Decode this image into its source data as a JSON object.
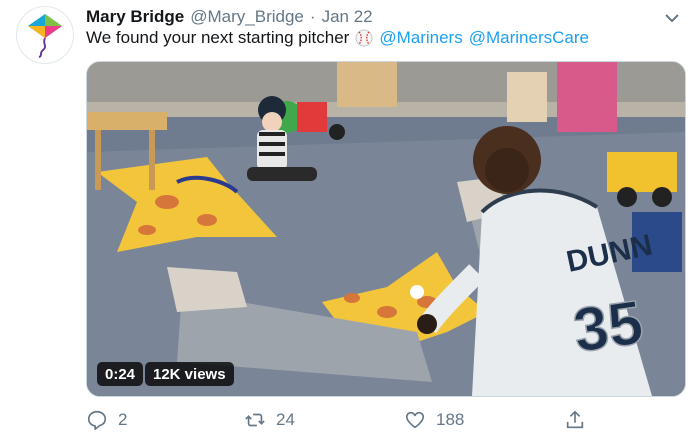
{
  "tweet": {
    "author_name": "Mary Bridge",
    "author_handle": "@Mary_Bridge",
    "separator": "·",
    "date": "Jan 22",
    "text": "We found your next starting pitcher",
    "emoji": "baseball-icon",
    "mentions": [
      "@Mariners",
      "@MarinersCare"
    ]
  },
  "video": {
    "duration": "0:24",
    "views": "12K views",
    "jersey_name": "DUNN",
    "jersey_number": "35"
  },
  "actions": {
    "reply_count": "2",
    "retweet_count": "24",
    "like_count": "188"
  },
  "colors": {
    "accent": "#1da1f2",
    "muted": "#657786",
    "text": "#14171a"
  }
}
